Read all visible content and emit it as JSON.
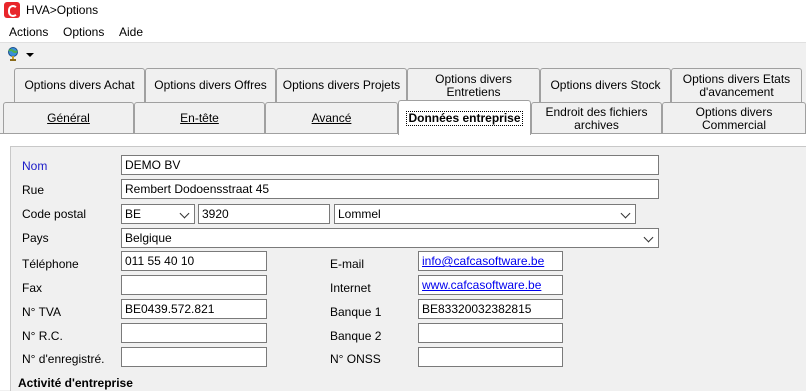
{
  "window": {
    "title": "HVA>Options"
  },
  "menu": {
    "items": [
      "Actions",
      "Options",
      "Aide"
    ]
  },
  "toolbar": {
    "icon": "globe-pin-icon"
  },
  "tabs": {
    "row1": [
      "Options divers  Achat",
      "Options divers  Offres",
      "Options divers  Projets",
      "Options divers  Entretiens",
      "Options divers  Stock",
      "Options divers  Etats d'avancement"
    ],
    "row2": [
      "Général",
      "En-tête",
      "Avancé",
      "Données entreprise",
      "Endroit des fichiers archives",
      "Options divers  Commercial"
    ],
    "active": "Données entreprise"
  },
  "form": {
    "name": {
      "label": "Nom",
      "value": "DEMO BV"
    },
    "street": {
      "label": "Rue",
      "value": "Rembert Dodoensstraat 45"
    },
    "postal": {
      "label": "Code postal",
      "country_code": "BE",
      "code": "3920",
      "city": "Lommel"
    },
    "country": {
      "label": "Pays",
      "value": "Belgique"
    },
    "phone": {
      "label": "Téléphone",
      "value": "011 55 40 10"
    },
    "fax": {
      "label": "Fax",
      "value": ""
    },
    "vat": {
      "label": "N° TVA",
      "value": "BE0439.572.821"
    },
    "rc": {
      "label": "N° R.C.",
      "value": ""
    },
    "registration": {
      "label": "N° d'enregistré.",
      "value": ""
    },
    "email": {
      "label": "E-mail",
      "value": "info@cafcasoftware.be"
    },
    "internet": {
      "label": "Internet",
      "value": "www.cafcasoftware.be"
    },
    "bank1": {
      "label": "Banque 1",
      "value": "BE83320032382815"
    },
    "bank2": {
      "label": "Banque 2",
      "value": ""
    },
    "onss": {
      "label": "N° ONSS",
      "value": ""
    }
  },
  "section": {
    "activity_title": "Activité d'entreprise"
  }
}
